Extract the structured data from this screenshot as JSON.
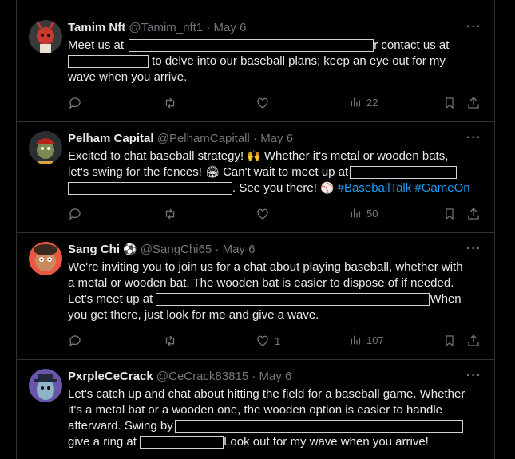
{
  "tweets": [
    {
      "name": "Tamim Nft",
      "handle": "@Tamim_nft1",
      "date": "May 6",
      "lines": [
        {
          "a": "Meet us at ",
          "b": "r contact us at"
        },
        {
          "a": "",
          "b": " to delve into our baseball plans; keep an eye out for my"
        },
        {
          "a": "wave when you arrive.",
          "b": ""
        }
      ],
      "views": "22",
      "likes": ""
    },
    {
      "name": "Pelham Capital",
      "handle": "@PelhamCapitall",
      "date": "May 6",
      "lines": [
        {
          "a": "Excited to chat baseball strategy! ",
          "e": "🙌",
          "b": " Whether it's metal or wooden bats,"
        },
        {
          "a": "let's swing for the fences! ",
          "e": "🏟",
          "b": " Can't wait to meet up at"
        },
        {
          "a": "",
          "b": ". See you there! ",
          "e2": "⚾",
          "tags": "#BaseballTalk #GameOn"
        }
      ],
      "views": "50",
      "likes": ""
    },
    {
      "name": "Sang Chi",
      "badge": "⚽",
      "handle": "@SangChi65",
      "date": "May 6",
      "lines": [
        {
          "a": "We're inviting you to join us for a chat about playing baseball, whether with"
        },
        {
          "a": "a metal or wooden bat. The wooden bat is easier to dispose of if needed."
        },
        {
          "a": "Let's meet up at ",
          "b": "When"
        },
        {
          "a": "you get there, just look for me and give a wave."
        }
      ],
      "views": "107",
      "likes": "1"
    },
    {
      "name": "PxrpleCeCrack",
      "handle": "@CeCrack83815",
      "date": "May 6",
      "lines": [
        {
          "a": "Let's catch up and chat about hitting the field for a baseball game. Whether"
        },
        {
          "a": "it's a metal bat or a wooden one, the wooden option is easier to handle"
        },
        {
          "a": "afterward. Swing by"
        },
        {
          "a": "give a ring at ",
          "b": "Look out for my wave when you arrive!"
        }
      ]
    }
  ],
  "separator": "·",
  "more_icon": "···",
  "colors": {
    "background": "#000000",
    "text": "#e7e9ea",
    "muted": "#71767b",
    "link": "#1d9bf0",
    "border": "#2f3336"
  }
}
